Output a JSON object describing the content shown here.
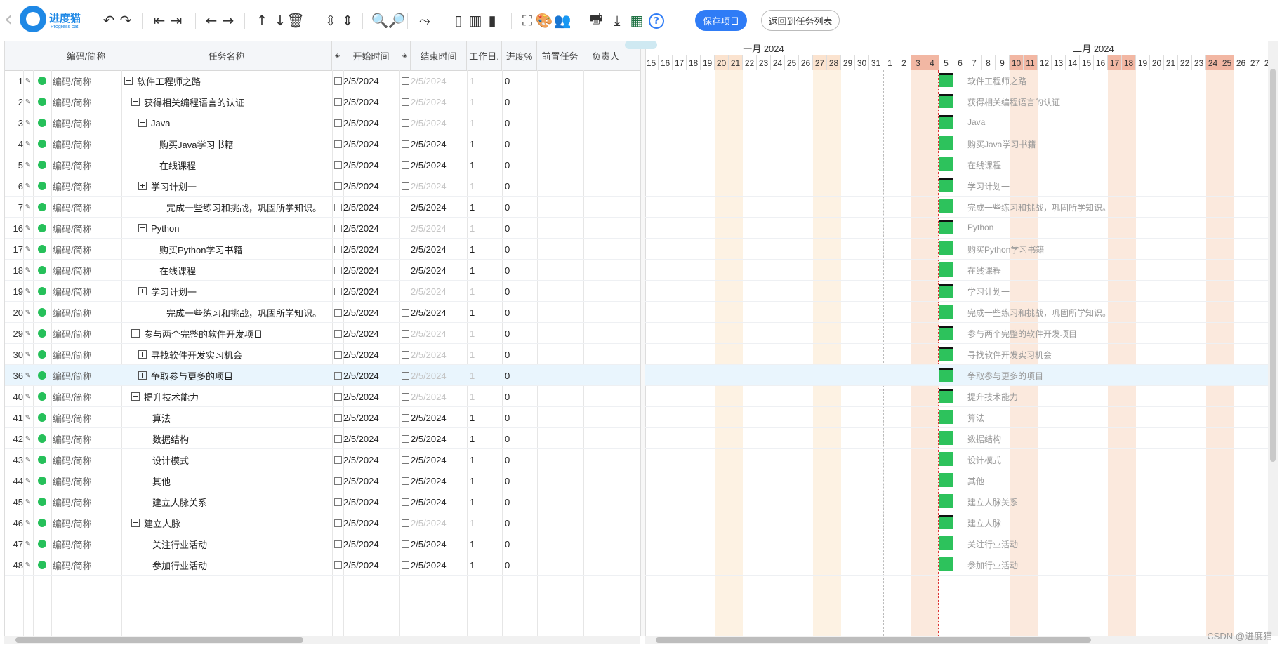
{
  "toolbar": {
    "logo_text": "进度猫",
    "logo_sub": "Progress cat",
    "icons": [
      {
        "name": "undo-icon",
        "glyph": "↶"
      },
      {
        "name": "redo-icon",
        "glyph": "↷"
      },
      {
        "name": "outdent-icon",
        "glyph": "⇤"
      },
      {
        "name": "indent-icon",
        "glyph": "⇥"
      },
      {
        "name": "move-left-icon",
        "glyph": "←"
      },
      {
        "name": "move-right-icon",
        "glyph": "→"
      },
      {
        "name": "move-up-icon",
        "glyph": "↑"
      },
      {
        "name": "move-down-icon",
        "glyph": "↓"
      },
      {
        "name": "delete-icon",
        "glyph": "🗑"
      },
      {
        "name": "expand-all-icon",
        "glyph": "⇳"
      },
      {
        "name": "collapse-all-icon",
        "glyph": "⇕"
      },
      {
        "name": "zoom-out-icon",
        "glyph": "🔍"
      },
      {
        "name": "zoom-in-icon",
        "glyph": "🔎"
      },
      {
        "name": "link-icon",
        "glyph": "⤳"
      },
      {
        "name": "layout-grid-icon",
        "glyph": "▯"
      },
      {
        "name": "layout-split-icon",
        "glyph": "▥"
      },
      {
        "name": "layout-gantt-icon",
        "glyph": "▮"
      },
      {
        "name": "fullscreen-icon",
        "glyph": "⛶"
      },
      {
        "name": "palette-icon",
        "glyph": "🎨"
      },
      {
        "name": "users-icon",
        "glyph": "👥"
      },
      {
        "name": "print-icon",
        "glyph": "🖶"
      },
      {
        "name": "download-icon",
        "glyph": "⤓"
      },
      {
        "name": "excel-icon",
        "glyph": "▦"
      },
      {
        "name": "help-icon",
        "glyph": "?"
      }
    ],
    "save_label": "保存项目",
    "back_label": "返回到任务列表"
  },
  "grid": {
    "columns": [
      "编码/简称",
      "任务名称",
      "开始时间",
      "结束时间",
      "工作日.",
      "进度%",
      "前置任务",
      "负责人"
    ],
    "rows": [
      {
        "id": "1",
        "code": "编码/简称",
        "name": "软件工程师之路",
        "level": 0,
        "toggle": "minus",
        "start": "2/5/2024",
        "end": "2/5/2024",
        "work": "1",
        "progress": "0",
        "muted": true
      },
      {
        "id": "2",
        "code": "编码/简称",
        "name": "获得相关编程语言的认证",
        "level": 1,
        "toggle": "minus",
        "start": "2/5/2024",
        "end": "2/5/2024",
        "work": "1",
        "progress": "0",
        "muted": true
      },
      {
        "id": "3",
        "code": "编码/简称",
        "name": "Java",
        "level": 2,
        "toggle": "minus",
        "start": "2/5/2024",
        "end": "2/5/2024",
        "work": "1",
        "progress": "0",
        "muted": true
      },
      {
        "id": "4",
        "code": "编码/简称",
        "name": "购买Java学习书籍",
        "level": 3,
        "toggle": "",
        "start": "2/5/2024",
        "end": "2/5/2024",
        "work": "1",
        "progress": "0",
        "muted": false
      },
      {
        "id": "5",
        "code": "编码/简称",
        "name": "在线课程",
        "level": 3,
        "toggle": "",
        "start": "2/5/2024",
        "end": "2/5/2024",
        "work": "1",
        "progress": "0",
        "muted": false
      },
      {
        "id": "6",
        "code": "编码/简称",
        "name": "学习计划一",
        "level": 2,
        "toggle": "plus",
        "start": "2/5/2024",
        "end": "2/5/2024",
        "work": "1",
        "progress": "0",
        "muted": true
      },
      {
        "id": "7",
        "code": "编码/简称",
        "name": "完成一些练习和挑战，巩固所学知识。",
        "level": 4,
        "toggle": "",
        "start": "2/5/2024",
        "end": "2/5/2024",
        "work": "1",
        "progress": "0",
        "muted": false
      },
      {
        "id": "16",
        "code": "编码/简称",
        "name": "Python",
        "level": 2,
        "toggle": "minus",
        "start": "2/5/2024",
        "end": "2/5/2024",
        "work": "1",
        "progress": "0",
        "muted": true
      },
      {
        "id": "17",
        "code": "编码/简称",
        "name": "购买Python学习书籍",
        "level": 3,
        "toggle": "",
        "start": "2/5/2024",
        "end": "2/5/2024",
        "work": "1",
        "progress": "0",
        "muted": false
      },
      {
        "id": "18",
        "code": "编码/简称",
        "name": "在线课程",
        "level": 3,
        "toggle": "",
        "start": "2/5/2024",
        "end": "2/5/2024",
        "work": "1",
        "progress": "0",
        "muted": false
      },
      {
        "id": "19",
        "code": "编码/简称",
        "name": "学习计划一",
        "level": 2,
        "toggle": "plus",
        "start": "2/5/2024",
        "end": "2/5/2024",
        "work": "1",
        "progress": "0",
        "muted": true
      },
      {
        "id": "20",
        "code": "编码/简称",
        "name": "完成一些练习和挑战，巩固所学知识。",
        "level": 4,
        "toggle": "",
        "start": "2/5/2024",
        "end": "2/5/2024",
        "work": "1",
        "progress": "0",
        "muted": false
      },
      {
        "id": "29",
        "code": "编码/简称",
        "name": "参与两个完整的软件开发项目",
        "level": 1,
        "toggle": "minus",
        "start": "2/5/2024",
        "end": "2/5/2024",
        "work": "1",
        "progress": "0",
        "muted": true
      },
      {
        "id": "30",
        "code": "编码/简称",
        "name": "寻找软件开发实习机会",
        "level": 2,
        "toggle": "plus",
        "start": "2/5/2024",
        "end": "2/5/2024",
        "work": "1",
        "progress": "0",
        "muted": true
      },
      {
        "id": "36",
        "code": "编码/简称",
        "name": "争取参与更多的项目",
        "level": 2,
        "toggle": "plus",
        "start": "2/5/2024",
        "end": "2/5/2024",
        "work": "1",
        "progress": "0",
        "muted": true,
        "selected": true
      },
      {
        "id": "40",
        "code": "编码/简称",
        "name": "提升技术能力",
        "level": 1,
        "toggle": "minus",
        "start": "2/5/2024",
        "end": "2/5/2024",
        "work": "1",
        "progress": "0",
        "muted": true
      },
      {
        "id": "41",
        "code": "编码/简称",
        "name": "算法",
        "level": 2.5,
        "toggle": "",
        "start": "2/5/2024",
        "end": "2/5/2024",
        "work": "1",
        "progress": "0",
        "muted": false
      },
      {
        "id": "42",
        "code": "编码/简称",
        "name": "数据结构",
        "level": 2.5,
        "toggle": "",
        "start": "2/5/2024",
        "end": "2/5/2024",
        "work": "1",
        "progress": "0",
        "muted": false
      },
      {
        "id": "43",
        "code": "编码/简称",
        "name": "设计模式",
        "level": 2.5,
        "toggle": "",
        "start": "2/5/2024",
        "end": "2/5/2024",
        "work": "1",
        "progress": "0",
        "muted": false
      },
      {
        "id": "44",
        "code": "编码/简称",
        "name": "其他",
        "level": 2.5,
        "toggle": "",
        "start": "2/5/2024",
        "end": "2/5/2024",
        "work": "1",
        "progress": "0",
        "muted": false
      },
      {
        "id": "45",
        "code": "编码/简称",
        "name": "建立人脉关系",
        "level": 2.5,
        "toggle": "",
        "start": "2/5/2024",
        "end": "2/5/2024",
        "work": "1",
        "progress": "0",
        "muted": false
      },
      {
        "id": "46",
        "code": "编码/简称",
        "name": "建立人脉",
        "level": 1,
        "toggle": "minus",
        "start": "2/5/2024",
        "end": "2/5/2024",
        "work": "1",
        "progress": "0",
        "muted": true
      },
      {
        "id": "47",
        "code": "编码/简称",
        "name": "关注行业活动",
        "level": 2.5,
        "toggle": "",
        "start": "2/5/2024",
        "end": "2/5/2024",
        "work": "1",
        "progress": "0",
        "muted": false
      },
      {
        "id": "48",
        "code": "编码/简称",
        "name": "参加行业活动",
        "level": 2.5,
        "toggle": "",
        "start": "2/5/2024",
        "end": "2/5/2024",
        "work": "1",
        "progress": "0",
        "muted": false
      }
    ]
  },
  "gantt": {
    "months": [
      "一月 2024",
      "二月 2024"
    ],
    "days": [
      {
        "d": "15",
        "t": ""
      },
      {
        "d": "16",
        "t": ""
      },
      {
        "d": "17",
        "t": ""
      },
      {
        "d": "18",
        "t": ""
      },
      {
        "d": "19",
        "t": ""
      },
      {
        "d": "20",
        "t": "wk"
      },
      {
        "d": "21",
        "t": "wk"
      },
      {
        "d": "22",
        "t": ""
      },
      {
        "d": "23",
        "t": ""
      },
      {
        "d": "24",
        "t": ""
      },
      {
        "d": "25",
        "t": ""
      },
      {
        "d": "26",
        "t": ""
      },
      {
        "d": "27",
        "t": "wk"
      },
      {
        "d": "28",
        "t": "wk"
      },
      {
        "d": "29",
        "t": ""
      },
      {
        "d": "30",
        "t": ""
      },
      {
        "d": "31",
        "t": ""
      },
      {
        "d": "1",
        "t": ""
      },
      {
        "d": "2",
        "t": ""
      },
      {
        "d": "3",
        "t": "hol"
      },
      {
        "d": "4",
        "t": "hol"
      },
      {
        "d": "5",
        "t": ""
      },
      {
        "d": "6",
        "t": ""
      },
      {
        "d": "7",
        "t": ""
      },
      {
        "d": "8",
        "t": ""
      },
      {
        "d": "9",
        "t": ""
      },
      {
        "d": "10",
        "t": "hol"
      },
      {
        "d": "11",
        "t": "hol"
      },
      {
        "d": "12",
        "t": ""
      },
      {
        "d": "13",
        "t": ""
      },
      {
        "d": "14",
        "t": ""
      },
      {
        "d": "15",
        "t": ""
      },
      {
        "d": "16",
        "t": ""
      },
      {
        "d": "17",
        "t": "hol"
      },
      {
        "d": "18",
        "t": "hol"
      },
      {
        "d": "19",
        "t": ""
      },
      {
        "d": "20",
        "t": ""
      },
      {
        "d": "21",
        "t": ""
      },
      {
        "d": "22",
        "t": ""
      },
      {
        "d": "23",
        "t": ""
      },
      {
        "d": "24",
        "t": "hol"
      },
      {
        "d": "25",
        "t": "hol"
      },
      {
        "d": "26",
        "t": ""
      },
      {
        "d": "27",
        "t": ""
      },
      {
        "d": "28",
        "t": ""
      }
    ],
    "bar_color": "#2dc25c",
    "today_color": "#dd3333"
  },
  "watermark": "CSDN @进度猫"
}
